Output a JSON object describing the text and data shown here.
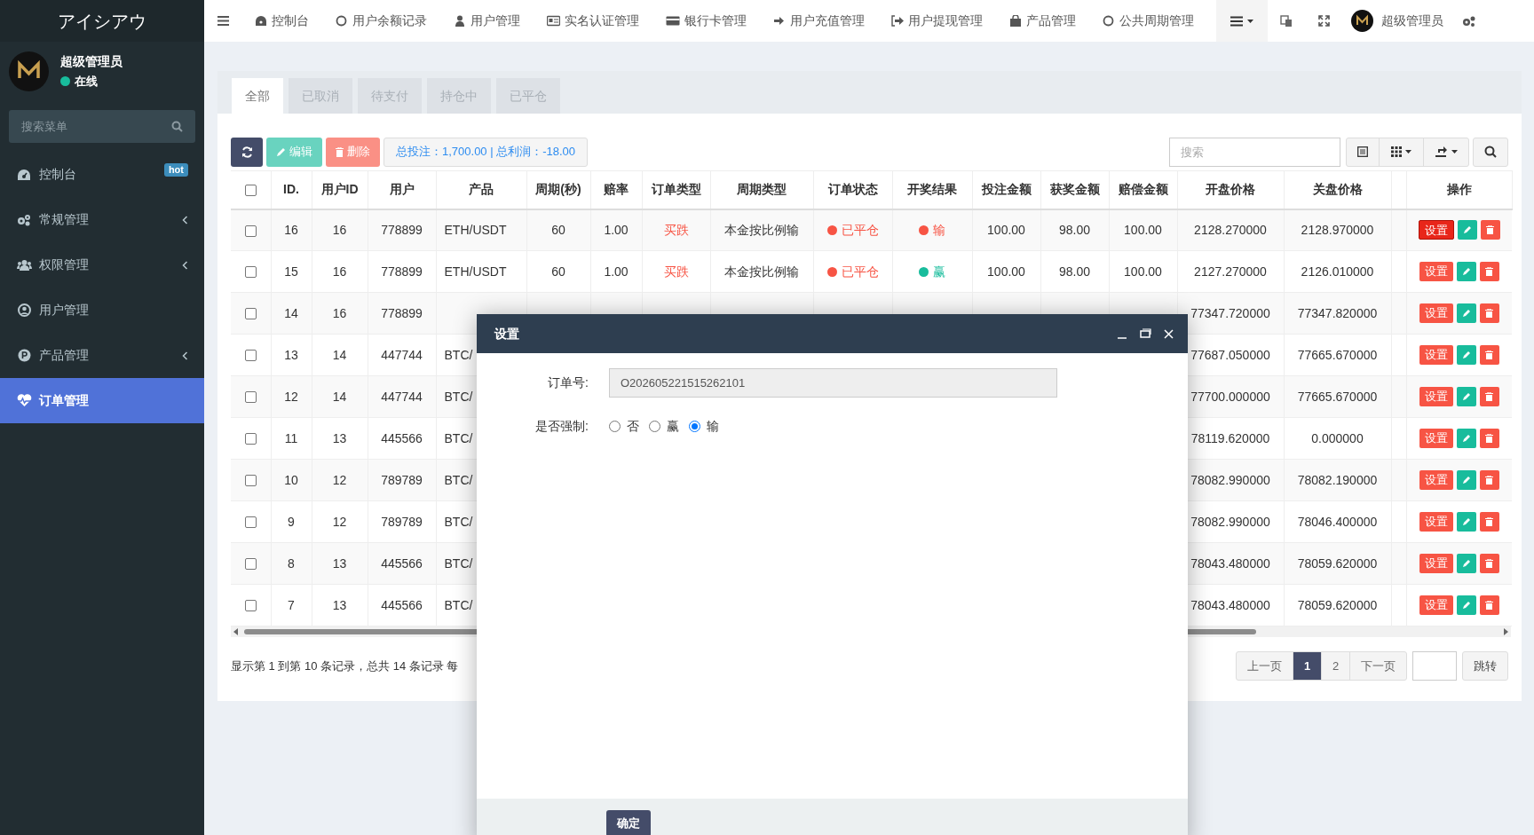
{
  "sidebar": {
    "logo": "アイシアウ",
    "user": {
      "name": "超级管理员",
      "status": "在线"
    },
    "search": {
      "placeholder": "搜索菜单"
    },
    "items": [
      {
        "label": "控制台",
        "badge": "hot",
        "expandable": false,
        "selected": false
      },
      {
        "label": "常规管理",
        "expandable": true,
        "selected": false
      },
      {
        "label": "权限管理",
        "expandable": true,
        "selected": false
      },
      {
        "label": "用户管理",
        "expandable": false,
        "selected": false
      },
      {
        "label": "产品管理",
        "expandable": true,
        "selected": false
      },
      {
        "label": "订单管理",
        "expandable": false,
        "selected": true
      }
    ]
  },
  "top_nav": {
    "items": [
      "控制台",
      "用户余额记录",
      "用户管理",
      "实名认证管理",
      "银行卡管理",
      "用户充值管理",
      "用户提现管理",
      "产品管理",
      "公共周期管理"
    ],
    "user": "超级管理员"
  },
  "tabs": [
    {
      "label": "全部",
      "selected": true
    },
    {
      "label": "已取消",
      "selected": false
    },
    {
      "label": "待支付",
      "selected": false
    },
    {
      "label": "持仓中",
      "selected": false
    },
    {
      "label": "已平仓",
      "selected": false
    }
  ],
  "toolbar": {
    "edit": {
      "label": "编辑",
      "disabled": true
    },
    "delete": {
      "label": "删除",
      "disabled": true
    },
    "summary": "总投注：1,700.00 | 总利润：-18.00",
    "search_placeholder": "搜索"
  },
  "table": {
    "select_all_checked": false,
    "columns": [
      "ID.",
      "用户ID",
      "用户",
      "产品",
      "周期(秒)",
      "赔率",
      "订单类型",
      "周期类型",
      "订单状态",
      "开奖结果",
      "投注金额",
      "获奖金额",
      "赔偿金额",
      "开盘价格",
      "关盘价格",
      "操作"
    ],
    "rows": [
      {
        "checked": false,
        "id": "16",
        "user_id": "16",
        "user": "778899",
        "product": "ETH/USDT",
        "period": "60",
        "odds": "1.00",
        "order_type": {
          "text": "买跌",
          "color": "#f75444"
        },
        "period_type": "本金按比例输",
        "status": {
          "text": "已平仓",
          "color": "#f75444"
        },
        "result": {
          "text": "输",
          "color": "#f75444"
        },
        "bet": "100.00",
        "win": "98.00",
        "compensation": "100.00",
        "open_price": "2128.270000",
        "close_price": "2128.970000",
        "action": "设置",
        "action_focused": true
      },
      {
        "checked": false,
        "id": "15",
        "user_id": "16",
        "user": "778899",
        "product": "ETH/USDT",
        "period": "60",
        "odds": "1.00",
        "order_type": {
          "text": "买跌",
          "color": "#f75444"
        },
        "period_type": "本金按比例输",
        "status": {
          "text": "已平仓",
          "color": "#f75444"
        },
        "result": {
          "text": "赢",
          "color": "#18bc9c"
        },
        "bet": "100.00",
        "win": "98.00",
        "compensation": "100.00",
        "open_price": "2127.270000",
        "close_price": "2126.010000",
        "action": "设置",
        "action_focused": false
      },
      {
        "checked": false,
        "id": "14",
        "user_id": "16",
        "user": "778899",
        "open_price": "77347.720000",
        "close_price": "77347.820000",
        "action": "设置",
        "action_focused": false
      },
      {
        "checked": false,
        "id": "13",
        "user_id": "14",
        "user": "447744",
        "product": "BTC/",
        "open_price": "77687.050000",
        "close_price": "77665.670000",
        "action": "设置",
        "action_focused": false
      },
      {
        "checked": false,
        "id": "12",
        "user_id": "14",
        "user": "447744",
        "product": "BTC/",
        "open_price": "77700.000000",
        "close_price": "77665.670000",
        "action": "设置",
        "action_focused": false
      },
      {
        "checked": false,
        "id": "11",
        "user_id": "13",
        "user": "445566",
        "product": "BTC/",
        "open_price": "78119.620000",
        "close_price": "0.000000",
        "action": "设置",
        "action_focused": false
      },
      {
        "checked": false,
        "id": "10",
        "user_id": "12",
        "user": "789789",
        "product": "BTC/",
        "open_price": "78082.990000",
        "close_price": "78082.190000",
        "action": "设置",
        "action_focused": false
      },
      {
        "checked": false,
        "id": "9",
        "user_id": "12",
        "user": "789789",
        "product": "BTC/",
        "open_price": "78082.990000",
        "close_price": "78046.400000",
        "action": "设置",
        "action_focused": false
      },
      {
        "checked": false,
        "id": "8",
        "user_id": "13",
        "user": "445566",
        "product": "BTC/",
        "open_price": "78043.480000",
        "close_price": "78059.620000",
        "action": "设置",
        "action_focused": false
      },
      {
        "checked": false,
        "id": "7",
        "user_id": "13",
        "user": "445566",
        "product": "BTC/",
        "open_price": "78043.480000",
        "close_price": "78059.620000",
        "action": "设置",
        "action_focused": false
      }
    ]
  },
  "footer": {
    "summary": "显示第 1 到第 10 条记录，总共 14 条记录 每",
    "pagination": {
      "prev": "上一页",
      "pages": [
        {
          "label": "1",
          "selected": true
        },
        {
          "label": "2",
          "selected": false
        }
      ],
      "next": "下一页",
      "jump": "跳转"
    }
  },
  "dialog": {
    "title": "设置",
    "fields": [
      {
        "label": "订单号:",
        "value": "O202605221515262101"
      }
    ],
    "force": {
      "label": "是否强制:",
      "options": [
        {
          "label": "否",
          "selected": false
        },
        {
          "label": "赢",
          "selected": false
        },
        {
          "label": "输",
          "selected": true
        }
      ]
    },
    "confirm": "确定"
  }
}
